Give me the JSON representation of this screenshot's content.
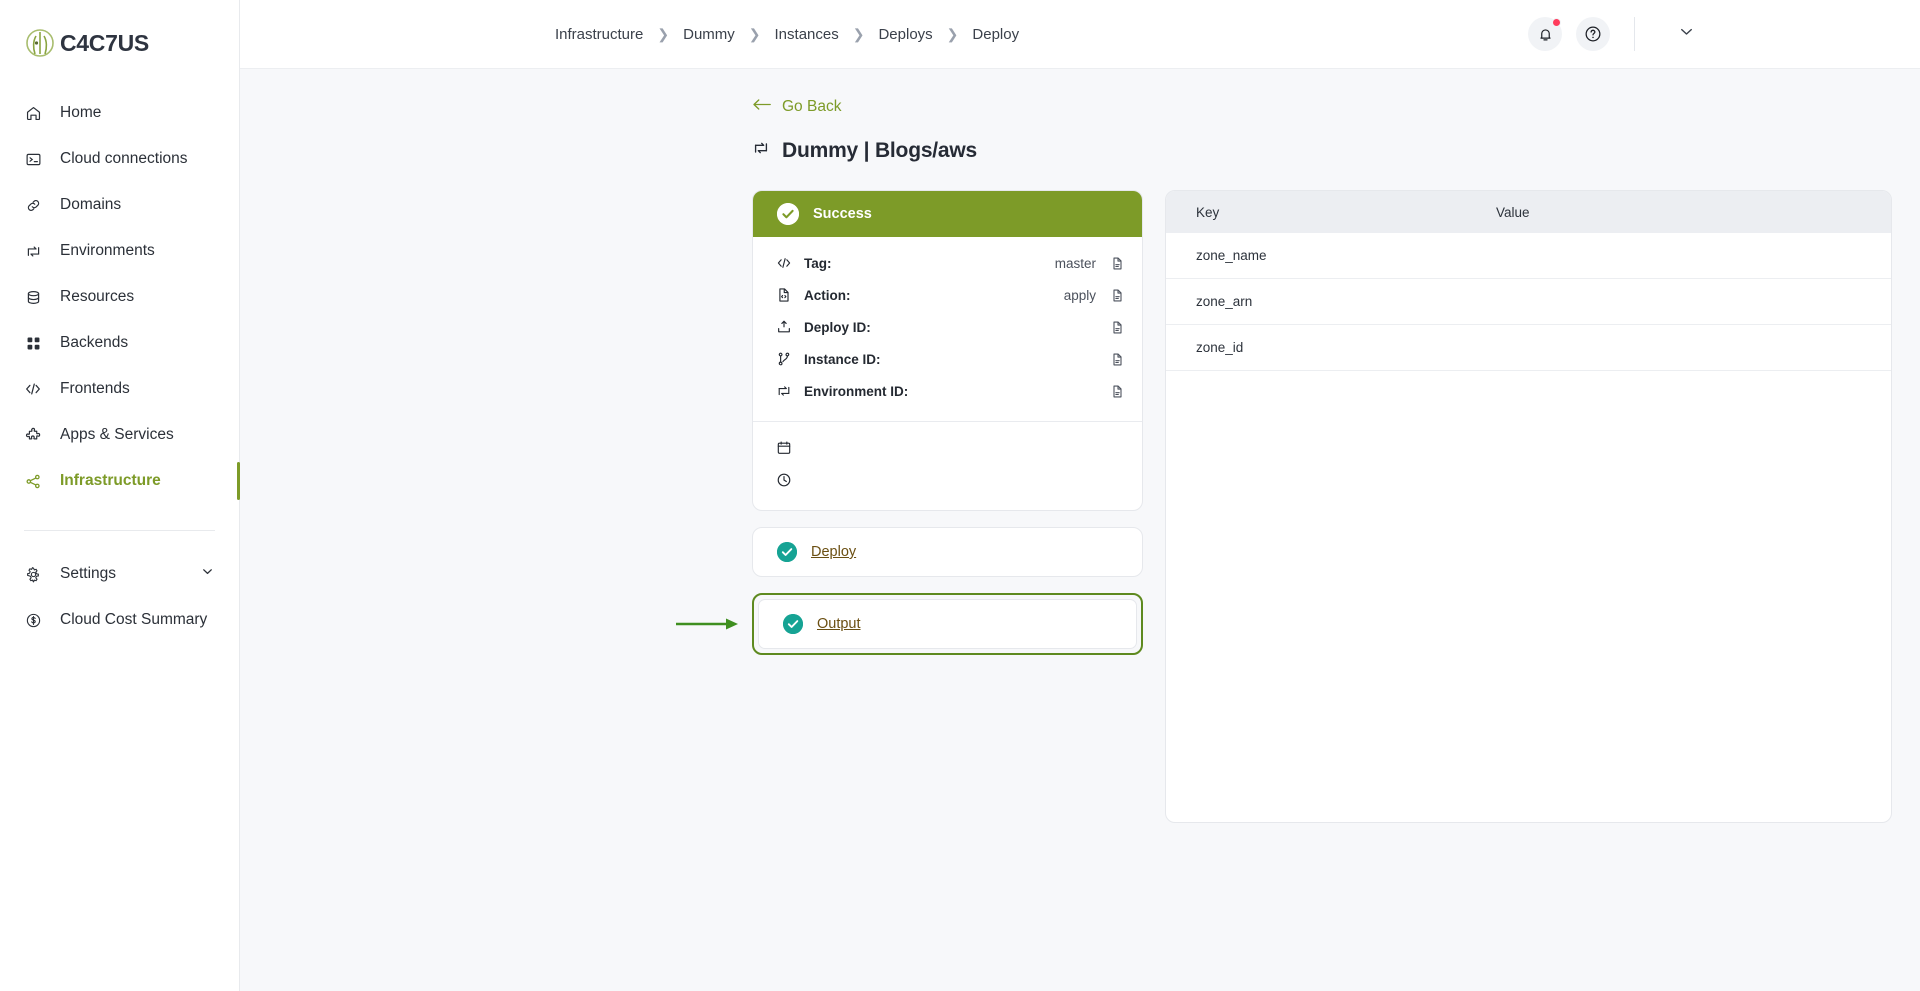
{
  "brand": {
    "name": "C4C7US",
    "logo_icon": "plant-leaf-logo-icon"
  },
  "sidebar": {
    "items": [
      {
        "label": "Home",
        "icon": "home-icon",
        "active": false
      },
      {
        "label": "Cloud connections",
        "icon": "terminal-icon",
        "active": false
      },
      {
        "label": "Domains",
        "icon": "link-icon",
        "active": false
      },
      {
        "label": "Environments",
        "icon": "swap-icon",
        "active": false
      },
      {
        "label": "Resources",
        "icon": "database-icon",
        "active": false
      },
      {
        "label": "Backends",
        "icon": "grid-icon",
        "active": false
      },
      {
        "label": "Frontends",
        "icon": "code-icon",
        "active": false
      },
      {
        "label": "Apps & Services",
        "icon": "puzzle-icon",
        "active": false
      },
      {
        "label": "Infrastructure",
        "icon": "share-nodes-icon",
        "active": true
      }
    ],
    "bottom_items": [
      {
        "label": "Settings",
        "icon": "gear-icon",
        "chevron": "chevron-down-icon"
      },
      {
        "label": "Cloud Cost Summary",
        "icon": "dollar-circle-icon"
      }
    ]
  },
  "topbar": {
    "breadcrumb": [
      "Infrastructure",
      "Dummy",
      "Instances",
      "Deploys",
      "Deploy"
    ],
    "separator": "›",
    "notification_icon": "bell-icon",
    "help_icon": "question-circle-icon",
    "account_chevron_icon": "chevron-down-icon",
    "has_notification_badge": true
  },
  "page": {
    "go_back": "Go Back",
    "back_arrow_icon": "arrow-left-icon",
    "title": "Dummy | Blogs/aws",
    "title_icon": "swap-icon"
  },
  "deploy_card": {
    "status_label": "Success",
    "status_icon": "check-circle-icon",
    "status_color": "#7d9b28",
    "rows": [
      {
        "icon": "code-icon",
        "key": "Tag:",
        "value": "master",
        "copy_icon": "copy-icon"
      },
      {
        "icon": "file-code-icon",
        "key": "Action:",
        "value": "apply",
        "copy_icon": "copy-icon"
      },
      {
        "icon": "upload-icon",
        "key": "Deploy ID:",
        "value": "",
        "copy_icon": "copy-icon"
      },
      {
        "icon": "instance-icon",
        "key": "Instance ID:",
        "value": "",
        "copy_icon": "copy-icon"
      },
      {
        "icon": "swap-icon",
        "key": "Environment ID:",
        "value": "",
        "copy_icon": "copy-icon"
      }
    ],
    "meta_rows": [
      {
        "icon": "calendar-icon",
        "value": ""
      },
      {
        "icon": "clock-icon",
        "value": ""
      }
    ]
  },
  "steps": [
    {
      "label": "Deploy",
      "icon": "check-circle-icon",
      "highlighted": false
    },
    {
      "label": "Output",
      "icon": "check-circle-icon",
      "highlighted": true
    }
  ],
  "output_table": {
    "columns": [
      "Key",
      "Value"
    ],
    "rows": [
      {
        "key": "zone_name",
        "value": ""
      },
      {
        "key": "zone_arn",
        "value": ""
      },
      {
        "key": "zone_id",
        "value": ""
      }
    ]
  },
  "colors": {
    "brand_green": "#7d9b28",
    "highlight_green": "#5e8a1f",
    "teal": "#16a394",
    "badge_red": "#ff3b5c"
  }
}
